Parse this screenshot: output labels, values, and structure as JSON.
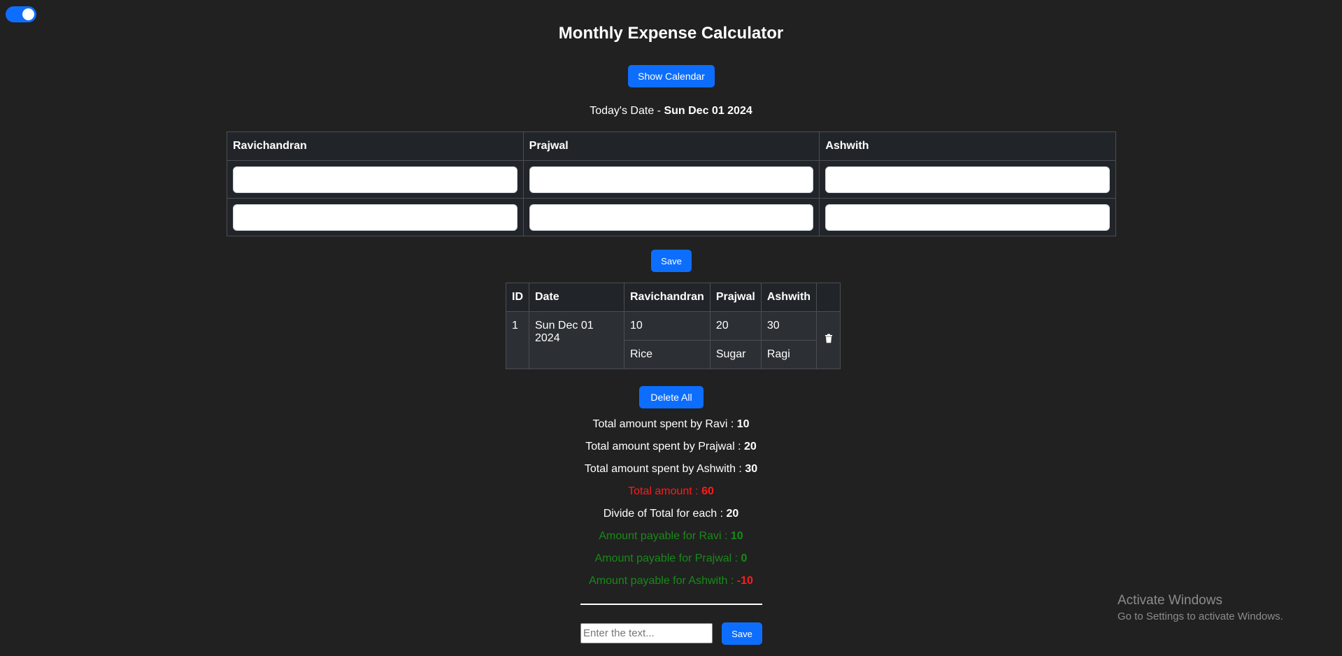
{
  "header": {
    "title": "Monthly Expense Calculator",
    "calendar_button": "Show Calendar",
    "date_label": "Today's Date - ",
    "date_value": "Sun Dec 01 2024"
  },
  "input_table": {
    "columns": [
      "Ravichandran",
      "Prajwal",
      "Ashwith"
    ],
    "rows": [
      [
        "",
        "",
        ""
      ],
      [
        "",
        "",
        ""
      ]
    ],
    "save_label": "Save"
  },
  "records_table": {
    "headers": [
      "ID",
      "Date",
      "Ravichandran",
      "Prajwal",
      "Ashwith",
      ""
    ],
    "records": [
      {
        "id": "1",
        "date": "Sun Dec 01 2024",
        "amounts": [
          "10",
          "20",
          "30"
        ],
        "items": [
          "Rice",
          "Sugar",
          "Ragi"
        ]
      }
    ],
    "delete_all_label": "Delete All"
  },
  "summary": {
    "ravi_label": "Total amount spent by Ravi : ",
    "ravi_value": "10",
    "prajwal_label": "Total amount spent by Prajwal : ",
    "prajwal_value": "20",
    "ashwith_label": "Total amount spent by Ashwith : ",
    "ashwith_value": "30",
    "total_label": "Total amount : ",
    "total_value": "60",
    "divide_label": "Divide of Total for each : ",
    "divide_value": "20",
    "payable_ravi_label": "Amount payable for Ravi : ",
    "payable_ravi_value": "10",
    "payable_prajwal_label": "Amount payable for Prajwal : ",
    "payable_prajwal_value": "0",
    "payable_ashwith_label": "Amount payable for Ashwith : ",
    "payable_ashwith_value": "-10"
  },
  "note": {
    "placeholder": "Enter the text...",
    "save_label": "Save"
  },
  "watermark": {
    "title": "Activate Windows",
    "subtitle": "Go to Settings to activate Windows."
  },
  "colors": {
    "background": "#212121",
    "accent": "#0d6efd",
    "total": "#ff1a1a",
    "payable": "#178a17"
  },
  "toggle": {
    "on": true
  }
}
